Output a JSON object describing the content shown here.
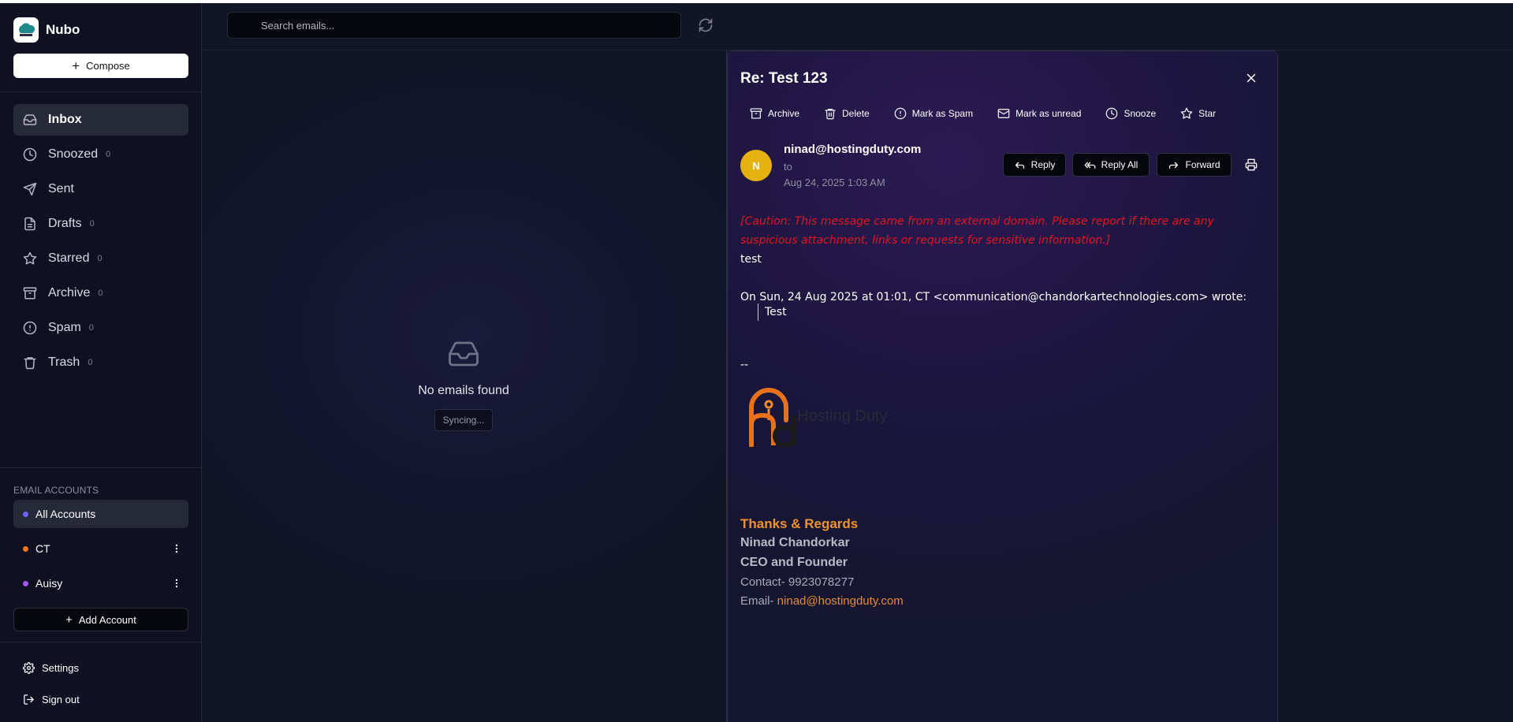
{
  "app": {
    "name": "Nubo",
    "compose_label": "Compose"
  },
  "nav": [
    {
      "label": "Inbox",
      "count": "",
      "icon": "inbox-icon",
      "active": true
    },
    {
      "label": "Snoozed",
      "count": "0",
      "icon": "clock-icon"
    },
    {
      "label": "Sent",
      "count": "",
      "icon": "send-icon"
    },
    {
      "label": "Drafts",
      "count": "0",
      "icon": "file-icon"
    },
    {
      "label": "Starred",
      "count": "0",
      "icon": "star-icon"
    },
    {
      "label": "Archive",
      "count": "0",
      "icon": "archive-icon"
    },
    {
      "label": "Spam",
      "count": "0",
      "icon": "alert-icon"
    },
    {
      "label": "Trash",
      "count": "0",
      "icon": "trash-icon"
    }
  ],
  "accounts": {
    "section_label": "EMAIL ACCOUNTS",
    "items": [
      {
        "label": "All Accounts",
        "color": "#6c63ff",
        "active": true
      },
      {
        "label": "CT",
        "color": "#f97316"
      },
      {
        "label": "Auisy",
        "color": "#a855f7"
      }
    ],
    "add_label": "Add Account"
  },
  "footer": {
    "settings_label": "Settings",
    "signout_label": "Sign out"
  },
  "search": {
    "placeholder": "Search emails...",
    "value": ""
  },
  "list": {
    "empty_title": "No emails found",
    "syncing_label": "Syncing..."
  },
  "email": {
    "subject": "Re: Test 123",
    "actions": [
      {
        "label": "Archive",
        "icon": "archive-icon"
      },
      {
        "label": "Delete",
        "icon": "trash-icon"
      },
      {
        "label": "Mark as Spam",
        "icon": "alert-icon"
      },
      {
        "label": "Mark as unread",
        "icon": "mail-icon"
      },
      {
        "label": "Snooze",
        "icon": "clock-icon"
      },
      {
        "label": "Star",
        "icon": "star-icon"
      }
    ],
    "avatar_initial": "N",
    "avatar_color": "#e6b210",
    "from": "ninad@hostingduty.com",
    "to_label": "to",
    "date": "Aug 24, 2025 1:03 AM",
    "reply_label": "Reply",
    "reply_all_label": "Reply All",
    "forward_label": "Forward",
    "caution": "[Caution: This message came from an external domain. Please report if there are any suspicious attachment, links or requests for sensitive information.]",
    "body_text": "test",
    "quote_header": "On Sun, 24 Aug 2025 at 01:01, CT <communication@chandorkartechnologies.com> wrote:",
    "quote_text": "Test",
    "sig_dash": "--",
    "logo_text": "Hosting Duty",
    "thanks": "Thanks & Regards",
    "sig_name": "Ninad Chandorkar",
    "sig_role": "CEO and Founder",
    "sig_contact": "Contact- 9923078277",
    "sig_email_prefix": "Email- ",
    "sig_email": "ninad@hostingduty.com"
  }
}
